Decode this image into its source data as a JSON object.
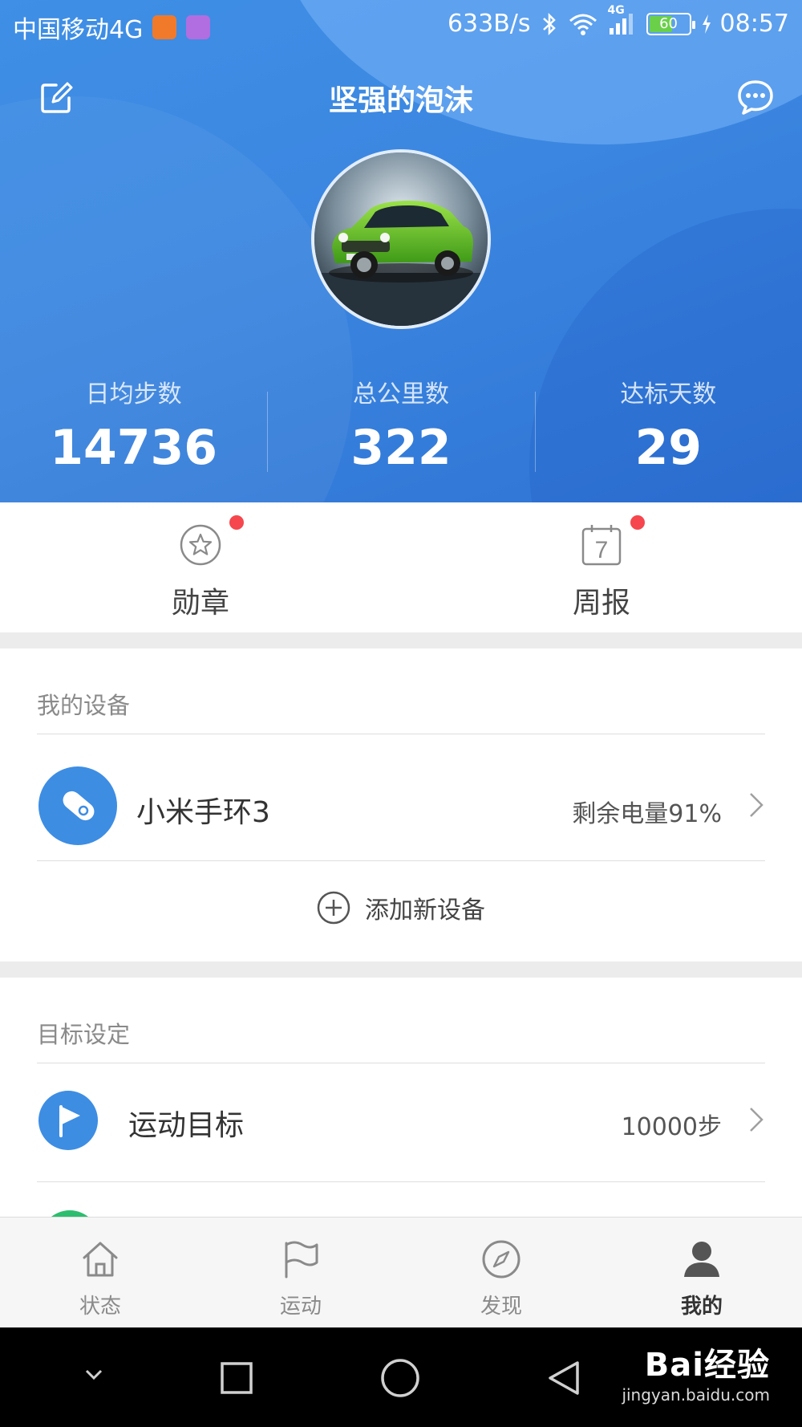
{
  "status_bar": {
    "carrier": "中国移动4G",
    "speed": "633B/s",
    "network": "4G",
    "battery": "60",
    "battery_level_pct": 60,
    "time": "08:57"
  },
  "header": {
    "title": "坚强的泡沫",
    "stats": [
      {
        "label": "日均步数",
        "value": "14736"
      },
      {
        "label": "总公里数",
        "value": "322"
      },
      {
        "label": "达标天数",
        "value": "29"
      }
    ]
  },
  "quick_entries": [
    {
      "label": "勋章",
      "icon": "medal-star-icon",
      "badge": true
    },
    {
      "label": "周报",
      "icon": "calendar-icon",
      "calendar_day": "7",
      "badge": true
    }
  ],
  "devices": {
    "heading": "我的设备",
    "items": [
      {
        "name": "小米手环3",
        "status": "剩余电量91%",
        "icon": "band-icon"
      }
    ],
    "add_label": "添加新设备"
  },
  "goals": {
    "heading": "目标设定",
    "items": [
      {
        "name": "运动目标",
        "value": "10000步",
        "icon": "flag-icon"
      }
    ]
  },
  "tabbar": [
    {
      "label": "状态",
      "icon": "home-icon",
      "active": false
    },
    {
      "label": "运动",
      "icon": "flag-outline-icon",
      "active": false
    },
    {
      "label": "发现",
      "icon": "compass-icon",
      "active": false
    },
    {
      "label": "我的",
      "icon": "person-icon",
      "active": true
    }
  ],
  "watermark": {
    "brand": "Bai经验",
    "url": "jingyan.baidu.com"
  },
  "colors": {
    "header_blue": "#3b86e0",
    "badge_red": "#f5474d",
    "device_icon_blue": "#3d8de3"
  }
}
